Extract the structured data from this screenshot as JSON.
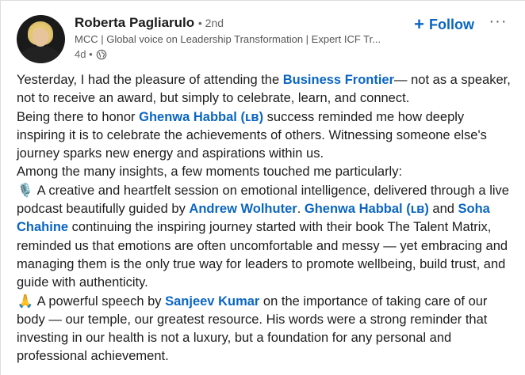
{
  "author": {
    "name": "Roberta Pagliarulo",
    "degree": "• 2nd",
    "headline": "MCC | Global voice on Leadership Transformation | Expert ICF Tr...",
    "time": "4d •"
  },
  "actions": {
    "follow_label": "Follow",
    "follow_icon": "+",
    "more_icon": "···"
  },
  "post": {
    "p1_prefix": "Yesterday, I had the pleasure of attending the ",
    "p1_link": "Business Frontier",
    "p1_suffix": "— not as a speaker, not to receive an award, but simply to celebrate, learn, and connect.",
    "p2_prefix": "Being there to honor ",
    "p2_link": "Ghenwa Habbal (ʟʙ)",
    "p2_suffix": " success reminded me how deeply inspiring it is to celebrate the achievements of others. Witnessing someone else's journey sparks new energy and aspirations within us.",
    "p3": "Among the many insights, a few moments touched me particularly:",
    "p4_emoji": "🎙️",
    "p4_prefix": " A creative and heartfelt session on emotional intelligence, delivered through a live podcast beautifully guided by ",
    "p4_link1": "Andrew Wolhuter",
    "p4_sep1": ". ",
    "p4_link2": "Ghenwa Habbal (ʟʙ)",
    "p4_sep2": " and ",
    "p4_link3": "Soha Chahine",
    "p4_suffix": " continuing the inspiring journey started with their book The Talent Matrix, reminded us that emotions are often uncomfortable and messy — yet embracing and managing them is the only true way for leaders to promote wellbeing, build trust, and guide with authenticity.",
    "p5_emoji": "🙏",
    "p5_prefix": " A powerful speech by ",
    "p5_link": "Sanjeev Kumar",
    "p5_suffix": " on the importance of taking care of our body — our temple, our greatest resource. His words were a strong reminder that investing in our health is not a luxury, but a foundation for any personal and professional achievement."
  },
  "colors": {
    "link": "#0a66c2",
    "text": "#1d1d1d",
    "muted": "#666666"
  }
}
